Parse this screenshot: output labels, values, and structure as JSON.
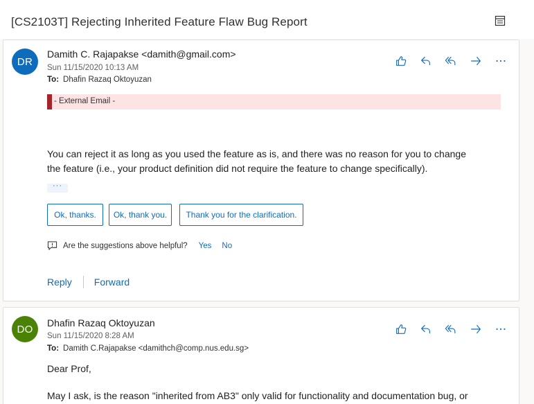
{
  "subject": "[CS2103T] Rejecting Inherited Feature Flaw Bug Report",
  "colors": {
    "accent": "#0f6cbd",
    "avatar1": "#0f6cbd",
    "avatar2": "#498205",
    "banner_bg": "#fde3e4",
    "banner_bar": "#a4262c"
  },
  "messages": [
    {
      "avatar_initials": "DR",
      "sender": "Damith C. Rajapakse <damith@gmail.com>",
      "date": "Sun 11/15/2020 10:13 AM",
      "to_label": "To:",
      "to": "Dhafin Razaq Oktoyuzan",
      "banner": "- External Email -",
      "body_line1": "You can reject it as long as you used the feature as is, and there was no reason for you to change",
      "body_line2": "the feature (i.e., your product definition did not require the feature to change specifically).",
      "expand_label": "···",
      "suggestions": [
        "Ok, thanks.",
        "Ok, thank you.",
        "Thank you for the clarification."
      ],
      "feedback_question": "Are the suggestions above helpful?",
      "feedback_yes": "Yes",
      "feedback_no": "No",
      "reply_label": "Reply",
      "forward_label": "Forward"
    },
    {
      "avatar_initials": "DO",
      "sender": "Dhafin Razaq Oktoyuzan",
      "date": "Sun 11/15/2020 8:28 AM",
      "to_label": "To:",
      "to": "Damith C.Rajapakse <damithch@comp.nus.edu.sg>",
      "body_line1": "Dear Prof,",
      "body_line2": "May I ask, is the reason \"inherited from AB3\" only valid for functionality and documentation bug, or"
    }
  ],
  "icons": [
    "popout-icon",
    "like-icon",
    "reply-icon",
    "reply-all-icon",
    "forward-icon",
    "more-icon",
    "feedback-icon"
  ]
}
